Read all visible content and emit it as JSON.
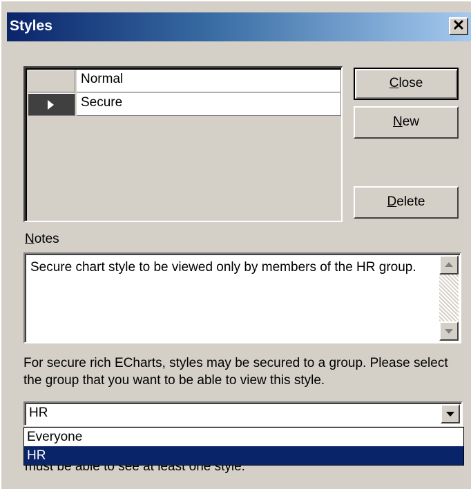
{
  "window": {
    "title": "Styles",
    "close_glyph": "✕"
  },
  "styles_grid": {
    "rows": [
      {
        "name": "Normal",
        "current": false
      },
      {
        "name": "Secure",
        "current": true
      }
    ]
  },
  "buttons": {
    "close": {
      "underlined": "C",
      "rest": "lose"
    },
    "new": {
      "underlined": "N",
      "rest": "ew"
    },
    "delete": {
      "underlined": "D",
      "rest": "elete"
    }
  },
  "notes": {
    "label_underlined": "N",
    "label_rest": "otes",
    "text": "Secure chart style to be viewed only by members of the HR group."
  },
  "description": "For secure rich ECharts, styles may be secured to a group. Please select the group that you want to be able to view this style.",
  "group_combo": {
    "value": "HR",
    "options": [
      "Everyone",
      "HR"
    ],
    "highlighted": "HR"
  },
  "partially_hidden_text": "must be able to see at least one style.",
  "icons": {
    "current_row": "right-triangle-icon",
    "scroll_up": "up-arrow-icon",
    "scroll_down": "down-arrow-icon",
    "dropdown": "down-arrow-icon"
  },
  "colors": {
    "title_start": "#0a246a",
    "title_end": "#a6caf0",
    "face": "#d4d0c8",
    "highlight": "#0a246a"
  }
}
